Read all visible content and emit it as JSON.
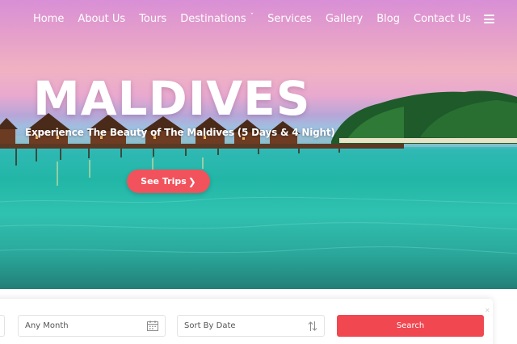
{
  "nav": {
    "items": [
      {
        "label": "Home"
      },
      {
        "label": "About Us"
      },
      {
        "label": "Tours"
      },
      {
        "label": "Destinations",
        "has_dropdown": true,
        "caret": "ˇ"
      },
      {
        "label": "Services"
      },
      {
        "label": "Gallery"
      },
      {
        "label": "Blog"
      },
      {
        "label": "Contact Us"
      }
    ],
    "menu_icon": "hamburger-icon"
  },
  "hero": {
    "title": "MALDIVES",
    "subtitle": "Experience The Beauty of The Maldives (5 Days & 4 Night)",
    "cta": {
      "label": "See Trips",
      "chevron": "❯"
    }
  },
  "search": {
    "month": {
      "placeholder": "Any Month",
      "icon": "calendar-icon"
    },
    "sort": {
      "placeholder": "Sort By Date",
      "icon": "sort-arrows-icon"
    },
    "button": "Search",
    "close_glyph": "✕"
  },
  "colors": {
    "accent": "#f2525b",
    "search_button": "#f04750",
    "nav_text": "#ffffff"
  }
}
